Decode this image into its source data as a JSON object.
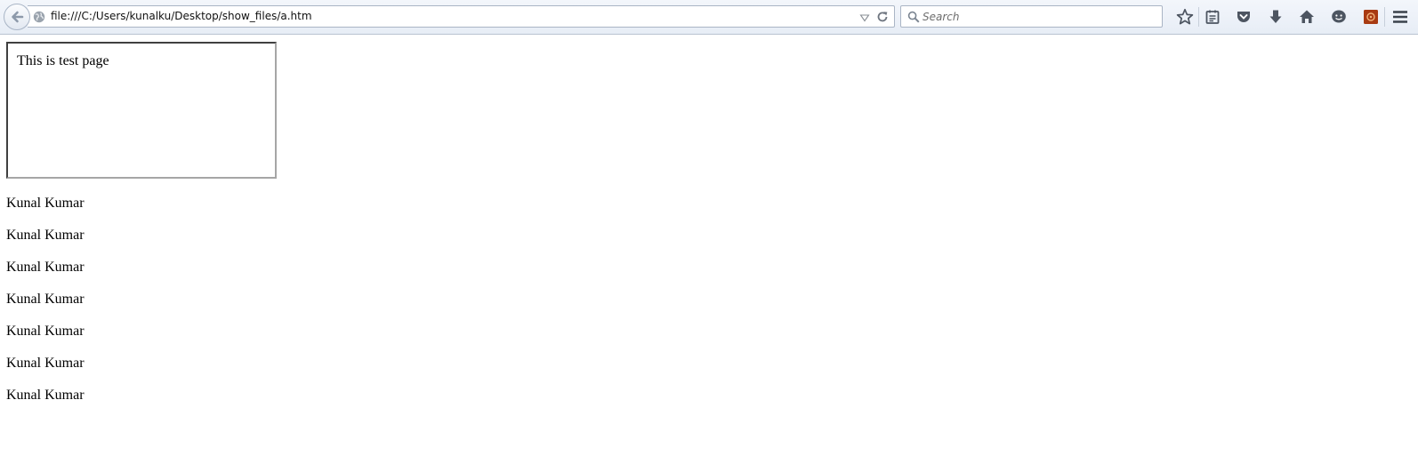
{
  "browser": {
    "url": "file:///C:/Users/kunalku/Desktop/show_files/a.htm",
    "search_placeholder": "Search",
    "toolbar_icons": [
      "star-icon",
      "reading-list-icon",
      "pocket-icon",
      "download-icon",
      "home-icon",
      "chat-icon",
      "addon-icon",
      "menu-icon"
    ],
    "addon_color": "#a83a12"
  },
  "page": {
    "frame_text": "This is test page",
    "names": [
      "Kunal Kumar",
      "Kunal Kumar",
      "Kunal Kumar",
      "Kunal Kumar",
      "Kunal Kumar",
      "Kunal Kumar",
      "Kunal Kumar"
    ]
  }
}
